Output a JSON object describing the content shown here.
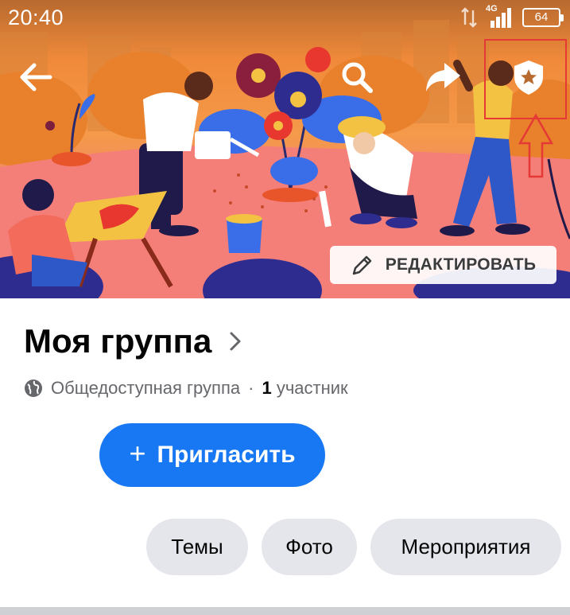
{
  "status_bar": {
    "time": "20:40",
    "network": "4G",
    "battery": "64"
  },
  "cover": {
    "nav": {
      "back_icon": "arrow-left-icon",
      "search_icon": "search-icon",
      "share_icon": "share-icon",
      "admin_icon": "admin-shield-star-icon"
    },
    "edit_label": "РЕДАКТИРОВАТЬ",
    "edit_icon": "pencil-icon"
  },
  "group": {
    "title": "Моя группа",
    "privacy_icon": "globe-icon",
    "privacy": "Общедоступная группа",
    "separator": "·",
    "member_count": "1",
    "member_label": "участник",
    "invite_plus": "+",
    "invite_label": "Пригласить"
  },
  "tabs": [
    {
      "label": "Темы"
    },
    {
      "label": "Фото"
    },
    {
      "label": "Мероприятия"
    }
  ],
  "colors": {
    "accent": "#1877f2",
    "annotation": "#e53935"
  }
}
